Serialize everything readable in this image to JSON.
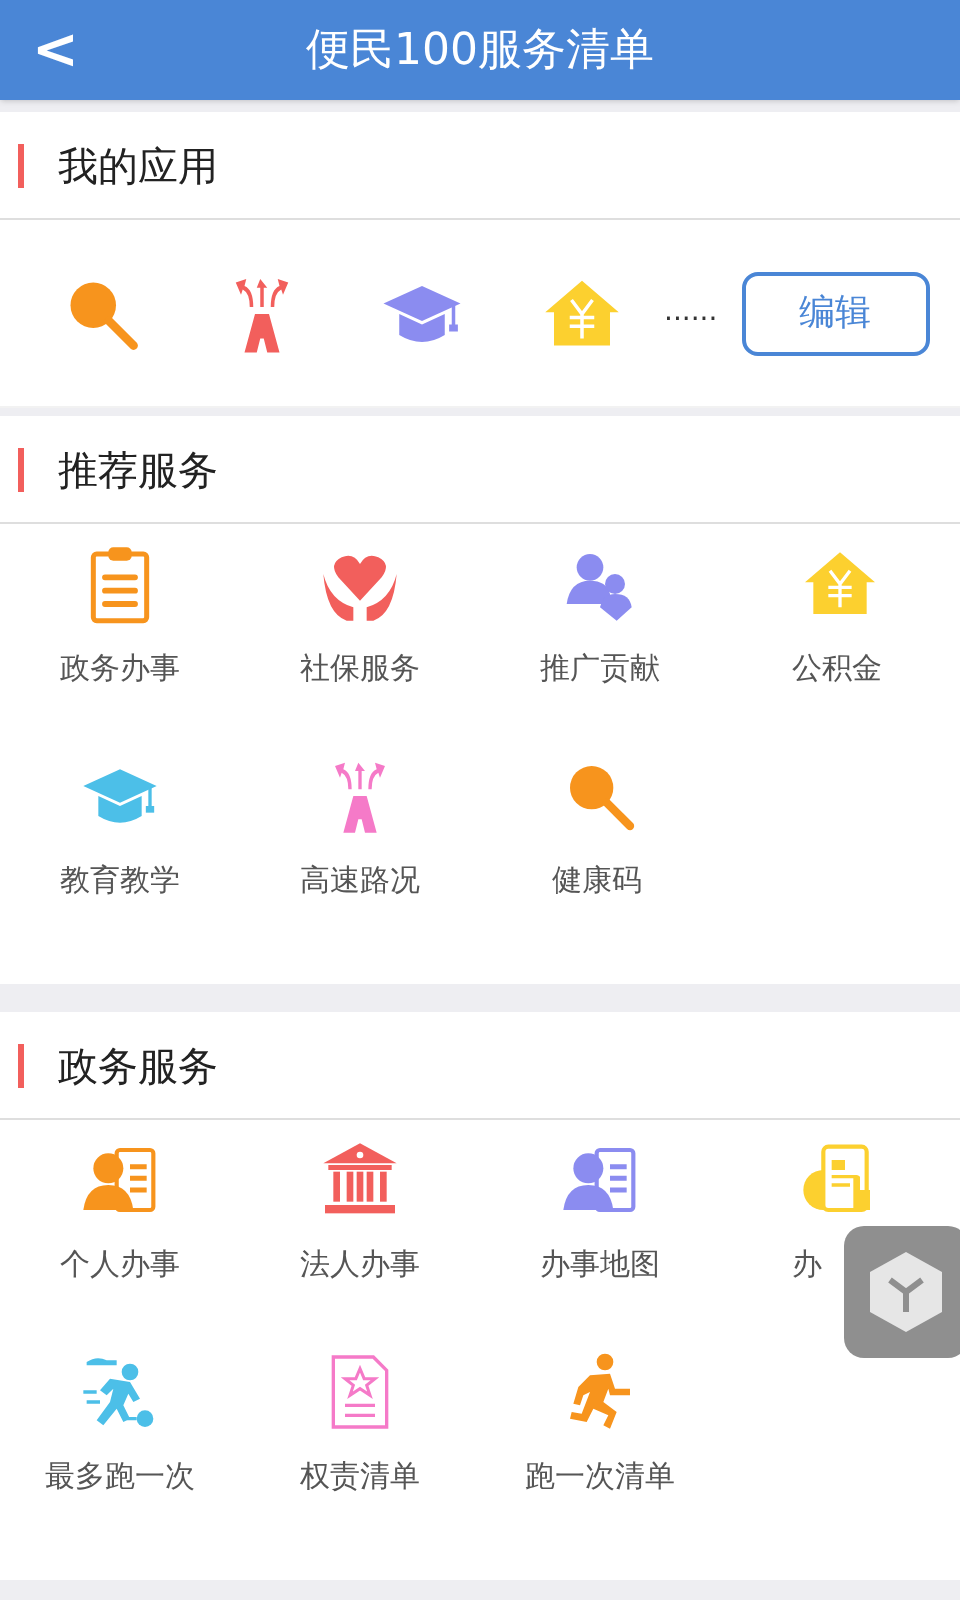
{
  "header": {
    "back": "<",
    "title": "便民100服务清单"
  },
  "my_apps": {
    "title": "我的应用",
    "apps": [
      {
        "kind": "search",
        "color": "#f7941d"
      },
      {
        "kind": "road",
        "color": "#f25f5c"
      },
      {
        "kind": "cap",
        "color": "#8b8cf0"
      },
      {
        "kind": "house",
        "color": "#fcd02f"
      }
    ],
    "more": "......",
    "edit_button": "编辑"
  },
  "sections": [
    {
      "title": "推荐服务",
      "items": [
        {
          "label": "政务办事",
          "kind": "clipboard",
          "color": "#f7941d"
        },
        {
          "label": "社保服务",
          "kind": "hands",
          "color": "#f25f5c"
        },
        {
          "label": "推广贡献",
          "kind": "people",
          "color": "#8b8cf0"
        },
        {
          "label": "公积金",
          "kind": "house",
          "color": "#fcd02f"
        },
        {
          "label": "教育教学",
          "kind": "cap",
          "color": "#4cbfe8"
        },
        {
          "label": "高速路况",
          "kind": "road",
          "color": "#f57ac8"
        },
        {
          "label": "健康码",
          "kind": "search",
          "color": "#f7941d"
        }
      ]
    },
    {
      "title": "政务服务",
      "items": [
        {
          "label": "个人办事",
          "kind": "card",
          "color": "#f7941d"
        },
        {
          "label": "法人办事",
          "kind": "bank",
          "color": "#f25f5c"
        },
        {
          "label": "办事地图",
          "kind": "card",
          "color": "#8b8cf0"
        },
        {
          "label": "办",
          "kind": "tablet",
          "color": "#fcd02f"
        },
        {
          "label": "最多跑一次",
          "kind": "runner",
          "color": "#4cbfe8"
        },
        {
          "label": "权责清单",
          "kind": "doc",
          "color": "#f57ac8"
        },
        {
          "label": "跑一次清单",
          "kind": "run",
          "color": "#f7941d"
        }
      ]
    }
  ]
}
